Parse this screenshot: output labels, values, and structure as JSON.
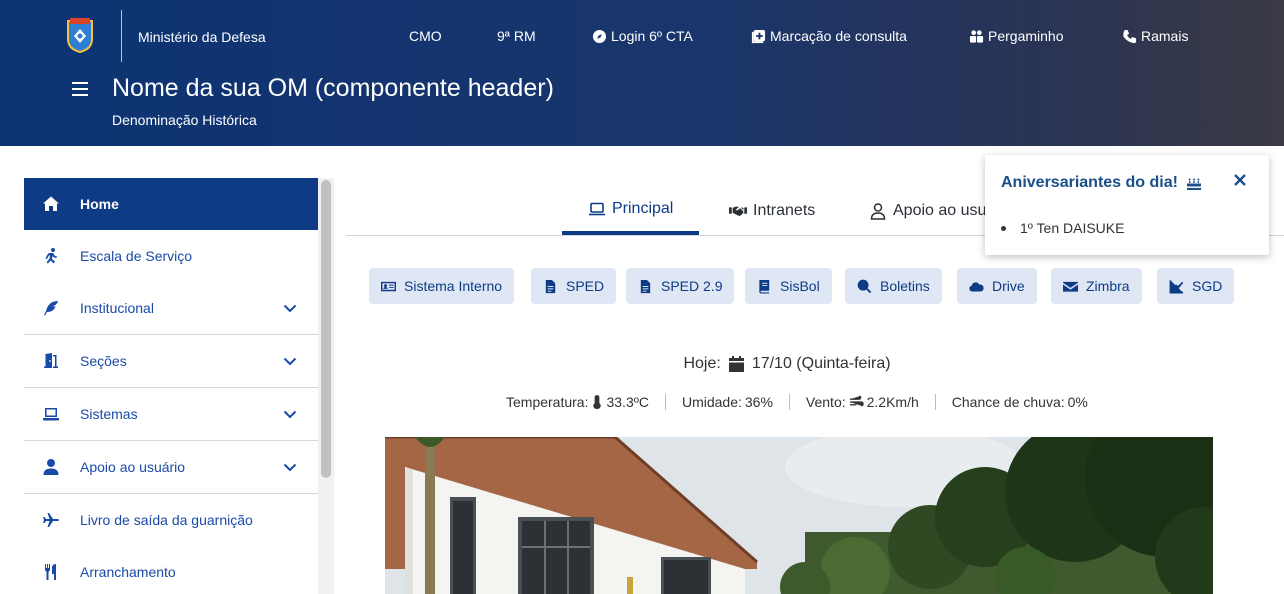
{
  "header": {
    "brand_name": "Ministério da Defesa",
    "site_title": "Nome da sua OM (componente header)",
    "site_subtitle": "Denominação Histórica",
    "top_links": [
      {
        "label": "CMO",
        "icon": ""
      },
      {
        "label": "9ª RM",
        "icon": ""
      },
      {
        "label": "Login 6º CTA",
        "icon": "compass-icon"
      },
      {
        "label": "Marcação de consulta",
        "icon": "medical-plus-icon"
      },
      {
        "label": "Pergaminho",
        "icon": "people-icon"
      },
      {
        "label": "Ramais",
        "icon": "phone-icon"
      }
    ]
  },
  "sidebar": {
    "items": [
      {
        "label": "Home",
        "icon": "home-icon",
        "active": true
      },
      {
        "label": "Escala de Serviço",
        "icon": "person-running-icon"
      },
      {
        "label": "Institucional",
        "icon": "feather-icon",
        "expandable": true
      },
      {
        "label": "Seções",
        "icon": "door-icon",
        "expandable": true
      },
      {
        "label": "Sistemas",
        "icon": "laptop-icon",
        "expandable": true
      },
      {
        "label": "Apoio ao usuário",
        "icon": "user-icon",
        "expandable": true
      },
      {
        "label": "Livro de saída da guarnição",
        "icon": "plane-icon"
      },
      {
        "label": "Arranchamento",
        "icon": "utensils-icon"
      }
    ]
  },
  "tabs": [
    {
      "label": "Principal",
      "icon": "laptop-icon",
      "active": true
    },
    {
      "label": "Intranets",
      "icon": "handshake-icon"
    },
    {
      "label": "Apoio ao usu",
      "icon": "user-icon"
    }
  ],
  "quick_links": [
    {
      "label": "Sistema Interno",
      "icon": "id-card-icon"
    },
    {
      "label": "SPED",
      "icon": "file-icon"
    },
    {
      "label": "SPED 2.9",
      "icon": "file-icon"
    },
    {
      "label": "SisBol",
      "icon": "book-icon"
    },
    {
      "label": "Boletins",
      "icon": "search-icon"
    },
    {
      "label": "Drive",
      "icon": "cloud-icon"
    },
    {
      "label": "Zimbra",
      "icon": "envelope-icon"
    },
    {
      "label": "SGD",
      "icon": "chart-line-icon"
    }
  ],
  "today": {
    "label": "Hoje:",
    "date": "17/10 (Quinta-feira)"
  },
  "weather": {
    "temperature_label": "Temperatura:",
    "temperature": "33.3ºC",
    "humidity_label": "Umidade:",
    "humidity": "36%",
    "wind_label": "Vento:",
    "wind": "2.2Km/h",
    "rain_label": "Chance de chuva:",
    "rain": "0%"
  },
  "birthday": {
    "title": "Aniversariantes do dia!",
    "people": [
      "1º Ten DAISUKE"
    ]
  },
  "colors": {
    "primary": "#0e3b85",
    "link": "#1a4aa8",
    "chip_bg": "#dfe7f5"
  }
}
